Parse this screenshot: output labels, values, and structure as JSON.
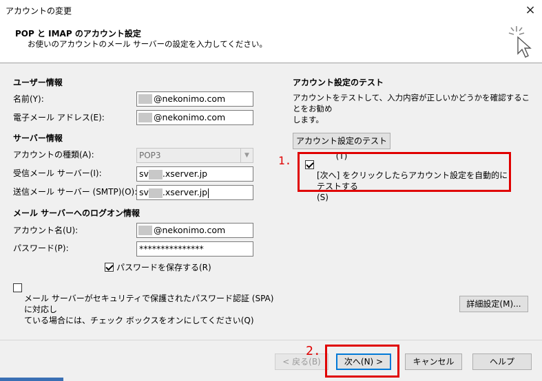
{
  "window": {
    "title": "アカウントの変更",
    "close_icon": "×"
  },
  "header": {
    "title": "POP と IMAP のアカウント設定",
    "subtitle": "お使いのアカウントのメール サーバーの設定を入力してください。"
  },
  "user_info": {
    "section_title": "ユーザー情報",
    "name_label": "名前(Y):",
    "name_value": "@nekonimo.com",
    "email_label": "電子メール アドレス(E):",
    "email_value": "@nekonimo.com"
  },
  "server_info": {
    "section_title": "サーバー情報",
    "account_type_label": "アカウントの種類(A):",
    "account_type_value": "POP3",
    "incoming_label": "受信メール サーバー(I):",
    "incoming_prefix": "sv",
    "incoming_suffix": ".xserver.jp",
    "outgoing_label": "送信メール サーバー (SMTP)(O):",
    "outgoing_prefix": "sv",
    "outgoing_suffix": ".xserver.jp"
  },
  "logon_info": {
    "section_title": "メール サーバーへのログオン情報",
    "account_name_label": "アカウント名(U):",
    "account_name_value": "@nekonimo.com",
    "password_label": "パスワード(P):",
    "password_value": "***************",
    "save_password_label": "パスワードを保存する(R)",
    "save_password_checked": true,
    "spa_label_line1": "メール サーバーがセキュリティで保護されたパスワード認証 (SPA) に対応し",
    "spa_label_line2": "ている場合には、チェック ボックスをオンにしてください(Q)",
    "spa_checked": false
  },
  "test_settings": {
    "section_title": "アカウント設定のテスト",
    "description_line1": "アカウントをテストして、入力内容が正しいかどうかを確認することをお勧め",
    "description_line2": "します。",
    "test_button": "アカウント設定のテスト(T)",
    "auto_test_label_line1": "[次へ] をクリックしたらアカウント設定を自動的にテストする",
    "auto_test_label_line2": "(S)",
    "auto_test_checked": true
  },
  "advanced_button": "詳細設定(M)...",
  "annotations": {
    "step1": "1.",
    "step2": "2."
  },
  "footer": {
    "back_button": "< 戻る(B)",
    "next_button": "次へ(N) >",
    "cancel_button": "キャンセル",
    "help_button": "ヘルプ"
  },
  "colors": {
    "annotation_red": "#e00000",
    "focus_blue": "#0078d7"
  }
}
